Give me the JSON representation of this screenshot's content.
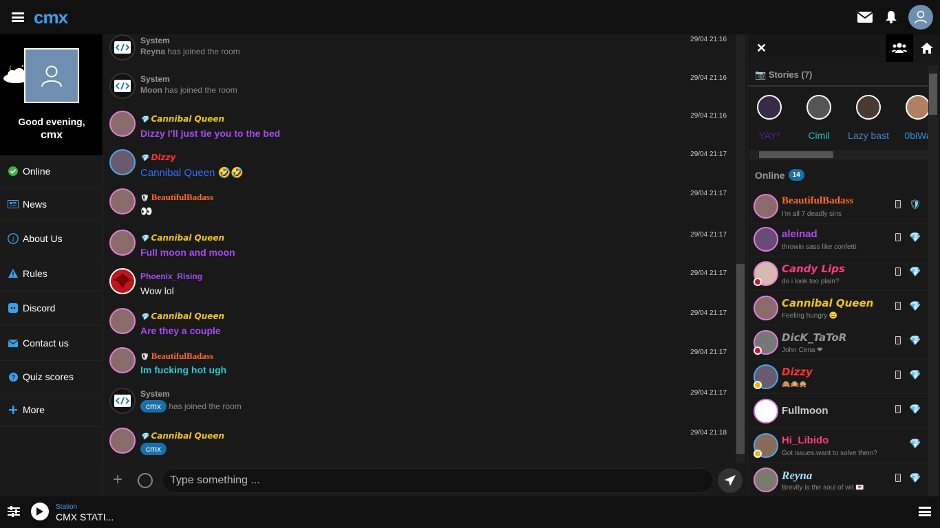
{
  "app": {
    "logo": "cmx"
  },
  "profile": {
    "greeting": "Good evening,",
    "username": "cmx"
  },
  "nav": [
    {
      "label": "Online",
      "icon": "check-circle-icon",
      "color": "#3cb043"
    },
    {
      "label": "News",
      "icon": "newspaper-icon",
      "color": "#3aa0ec"
    },
    {
      "label": "About Us",
      "icon": "info-icon",
      "color": "#3aa0ec"
    },
    {
      "label": "Rules",
      "icon": "warning-icon",
      "color": "#3aa0ec"
    },
    {
      "label": "Discord",
      "icon": "discord-icon",
      "color": "#3aa0ec"
    },
    {
      "label": "Contact us",
      "icon": "envelope-icon",
      "color": "#3aa0ec"
    },
    {
      "label": "Quiz scores",
      "icon": "question-circle-icon",
      "color": "#3aa0ec"
    },
    {
      "label": "More",
      "icon": "plus-icon",
      "color": "#3aa0ec"
    }
  ],
  "messages": [
    {
      "name": "System",
      "text_bold": "Reyna",
      "text": " has joined the room",
      "time": "29/04 21:16"
    },
    {
      "name": "System",
      "text_bold": "Moon",
      "text": " has joined the room",
      "time": "29/04 21:16"
    },
    {
      "name": "Cannibal Queen",
      "text": "Dizzy I'll just tie you to the bed",
      "time": "29/04 21:16"
    },
    {
      "name": "Dizzy",
      "text": "Cannibal Queen 🤣🤣",
      "time": "29/04 21:17"
    },
    {
      "name": "BeautifulBadass",
      "text": "👀",
      "time": "29/04 21:17"
    },
    {
      "name": "Cannibal Queen",
      "text": "Full moon and moon",
      "time": "29/04 21:17"
    },
    {
      "name": "Phoenix_Rising",
      "text": "Wow lol",
      "time": "29/04 21:17"
    },
    {
      "name": "Cannibal Queen",
      "text": "Are they a couple",
      "time": "29/04 21:17"
    },
    {
      "name": "BeautifulBadass",
      "text": "Im fucking hot ugh",
      "time": "29/04 21:17"
    },
    {
      "name": "System",
      "chip": "cmx",
      "text": " has joined the room",
      "time": "29/04 21:17"
    },
    {
      "name": "Cannibal Queen",
      "chip": "cmx",
      "time": "29/04 21:18"
    }
  ],
  "input": {
    "placeholder": "Type something ..."
  },
  "stories": {
    "header": "Stories (7)",
    "items": [
      "⁠YAYº",
      "Cimil",
      "Lazy bast",
      "0biWa"
    ]
  },
  "online": {
    "header": "Online",
    "count": "14",
    "users": [
      {
        "name": "BeautifulBadass",
        "status": "I'm all 7 deadly sins",
        "color": "#ff6a2a"
      },
      {
        "name": "aleinad",
        "status": "throwin sass like confetti",
        "color": "#b44cf0"
      },
      {
        "name": "Candy Lips",
        "status": "do i look too plain?",
        "color": "#ff3a86"
      },
      {
        "name": "Cannibal Queen",
        "status": "Feeling hungry 😑",
        "color": "#f0c419"
      },
      {
        "name": "DicK_TaToR",
        "status": "John Cena ❤",
        "color": "#999999"
      },
      {
        "name": "Dizzy",
        "status": "🙈🙉🙊",
        "color": "#ff3333"
      },
      {
        "name": "Fullmoon",
        "status": "",
        "color": "#cccccc"
      },
      {
        "name": "Hi_Libido",
        "status": "Got issues.want to solve them?",
        "color": "#ff3a86"
      },
      {
        "name": "Reyna",
        "status": "Brevity is the soul of wit 💌",
        "color": "#a0e0ff"
      }
    ]
  },
  "player": {
    "label": "Station",
    "name": "CMX STATI..."
  }
}
